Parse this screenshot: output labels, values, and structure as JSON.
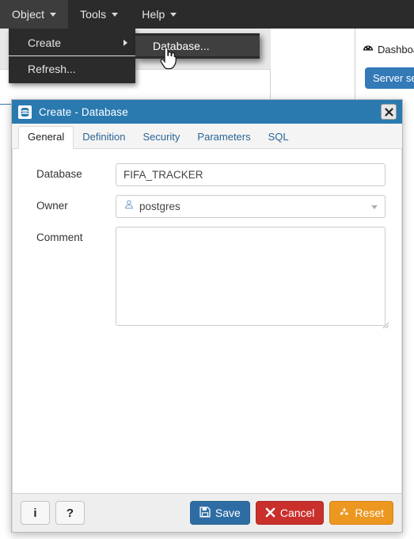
{
  "menubar": {
    "items": [
      {
        "label": "Object",
        "active": true
      },
      {
        "label": "Tools",
        "active": false
      },
      {
        "label": "Help",
        "active": false
      }
    ]
  },
  "dropdown": {
    "items": [
      {
        "label": "Create",
        "has_submenu": true
      },
      {
        "label": "Refresh...",
        "has_submenu": false
      }
    ]
  },
  "submenu": {
    "items": [
      {
        "label": "Database...",
        "highlighted": true
      }
    ]
  },
  "right_panel": {
    "tab_label": "Dashboard",
    "tab_icon": "gauge-icon",
    "button_label": "Server se"
  },
  "dialog": {
    "title": "Create - Database",
    "title_icon": "database-icon",
    "close_label": "✖",
    "accent_color": "#2a7ab0",
    "tabs": [
      {
        "label": "General",
        "active": true
      },
      {
        "label": "Definition",
        "active": false
      },
      {
        "label": "Security",
        "active": false
      },
      {
        "label": "Parameters",
        "active": false
      },
      {
        "label": "SQL",
        "active": false
      }
    ],
    "fields": {
      "database": {
        "label": "Database",
        "value": "FIFA_TRACKER",
        "placeholder": ""
      },
      "owner": {
        "label": "Owner",
        "value": "postgres",
        "icon": "user-icon"
      },
      "comment": {
        "label": "Comment",
        "value": "",
        "placeholder": ""
      }
    },
    "footer": {
      "info_label": "i",
      "help_label": "?",
      "save_label": "Save",
      "cancel_label": "Cancel",
      "reset_label": "Reset",
      "save_color": "#2e6da4",
      "cancel_color": "#c9302c",
      "reset_color": "#ec971f"
    }
  }
}
